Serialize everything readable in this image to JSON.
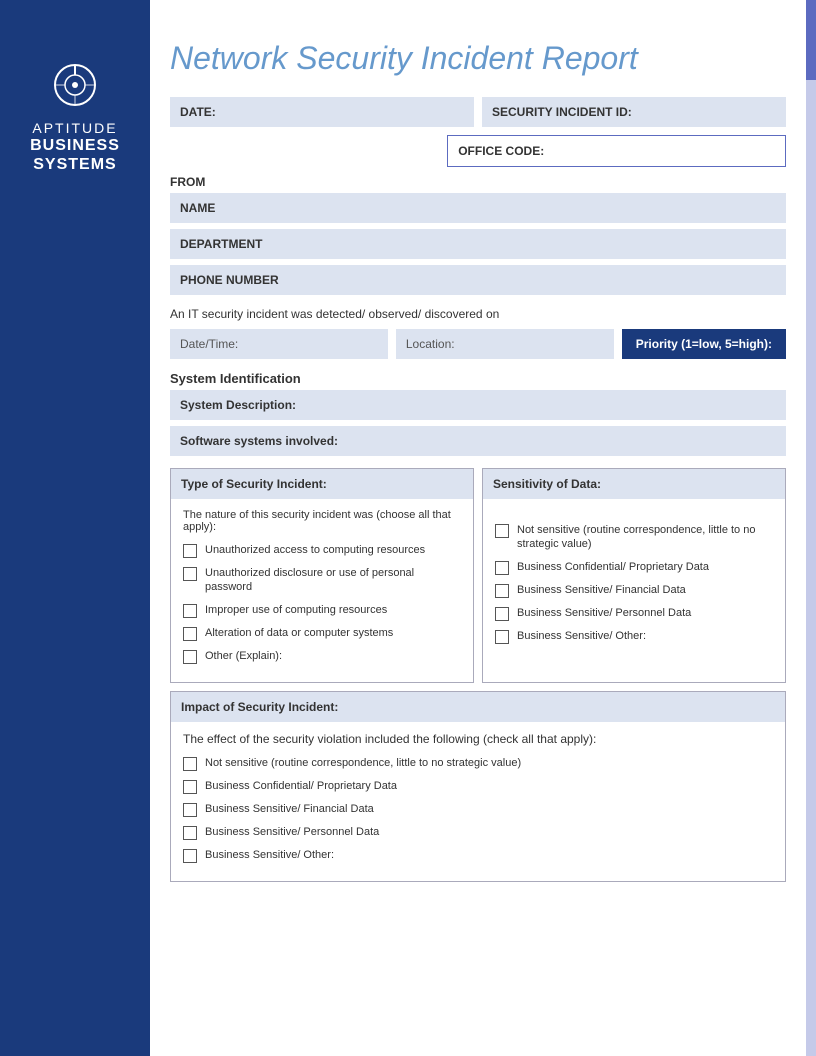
{
  "sidebar": {
    "brand_top": "APTITUDE",
    "brand_bottom_line1": "BUSINESS",
    "brand_bottom_line2": "SYSTEMS",
    "icon_symbol": "⊙"
  },
  "report": {
    "title": "Network Security Incident Report",
    "fields": {
      "date_label": "DATE:",
      "security_incident_id_label": "SECURITY INCIDENT ID:",
      "office_code_label": "OFFICE CODE:",
      "from_label": "FROM",
      "name_label": "NAME",
      "department_label": "DEPARTMENT",
      "phone_label": "PHONE NUMBER"
    },
    "incident": {
      "description": "An IT security incident was detected/ observed/ discovered on",
      "date_time_placeholder": "Date/Time:",
      "location_placeholder": "Location:",
      "priority_label": "Priority (1=low, 5=high):"
    },
    "system_identification": {
      "section_label": "System Identification",
      "system_description_label": "System Description:",
      "software_systems_label": "Software systems involved:"
    },
    "type_of_incident": {
      "header": "Type of Security Incident:",
      "sub_label": "The nature of this security incident was (choose all that apply):",
      "options": [
        "Unauthorized access to computing resources",
        "Unauthorized disclosure or use of personal password",
        "Improper use of computing resources",
        "Alteration of data or computer systems",
        "Other (Explain):"
      ]
    },
    "sensitivity": {
      "header": "Sensitivity of Data:",
      "options": [
        "Not sensitive (routine correspondence, little to no strategic value)",
        "Business Confidential/ Proprietary Data",
        "Business Sensitive/ Financial Data",
        "Business Sensitive/ Personnel Data",
        "Business Sensitive/ Other:"
      ]
    },
    "impact": {
      "header": "Impact of Security Incident:",
      "sub_label": "The effect of the security violation included the following (check all that apply):",
      "options": [
        "Not sensitive (routine correspondence, little to no strategic value)",
        "Business Confidential/ Proprietary Data",
        "Business Sensitive/ Financial Data",
        "Business Sensitive/ Personnel Data",
        "Business Sensitive/ Other:"
      ]
    }
  }
}
